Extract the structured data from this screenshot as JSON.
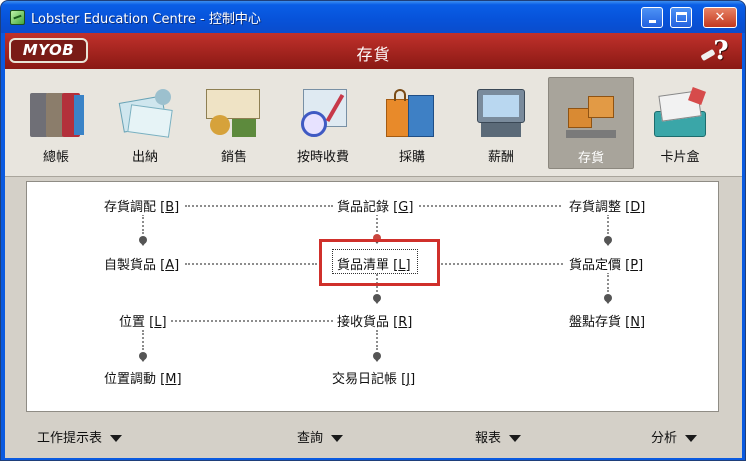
{
  "window": {
    "title": "Lobster Education Centre - 控制中心"
  },
  "banner": {
    "logo": "MYOB",
    "title": "存貨",
    "help": "?"
  },
  "modules": [
    {
      "label": "總帳",
      "icon": "binders-icon",
      "active": false
    },
    {
      "label": "出納",
      "icon": "bank-cards-icon",
      "active": false
    },
    {
      "label": "銷售",
      "icon": "invoice-money-icon",
      "active": false
    },
    {
      "label": "按時收費",
      "icon": "time-billing-icon",
      "active": false
    },
    {
      "label": "採購",
      "icon": "shopping-bags-icon",
      "active": false
    },
    {
      "label": "薪酬",
      "icon": "cash-register-icon",
      "active": false
    },
    {
      "label": "存貨",
      "icon": "inventory-boxes-icon",
      "active": true
    },
    {
      "label": "卡片盒",
      "icon": "card-file-icon",
      "active": false
    }
  ],
  "commands": {
    "count_inventory": {
      "text": "存貨調配",
      "key": "B"
    },
    "items_register": {
      "text": "貨品記錄",
      "key": "G"
    },
    "adjust_inventory": {
      "text": "存貨調整",
      "key": "D"
    },
    "build_items": {
      "text": "自製貨品",
      "key": "A"
    },
    "items_list": {
      "text": "貨品清單",
      "key": "L"
    },
    "set_item_prices": {
      "text": "貨品定價",
      "key": "P"
    },
    "locations": {
      "text": "位置",
      "key": "L"
    },
    "receive_items": {
      "text": "接收貨品",
      "key": "R"
    },
    "count_stock": {
      "text": "盤點存貨",
      "key": "N"
    },
    "move_items": {
      "text": "位置調動",
      "key": "M"
    },
    "transaction_journal": {
      "text": "交易日記帳",
      "key": "J"
    }
  },
  "bottom_bar": {
    "todo": "工作提示表",
    "find": "查詢",
    "reports": "報表",
    "analysis": "分析"
  },
  "colors": {
    "highlight": "#d0302b",
    "banner": "#a8231d"
  }
}
